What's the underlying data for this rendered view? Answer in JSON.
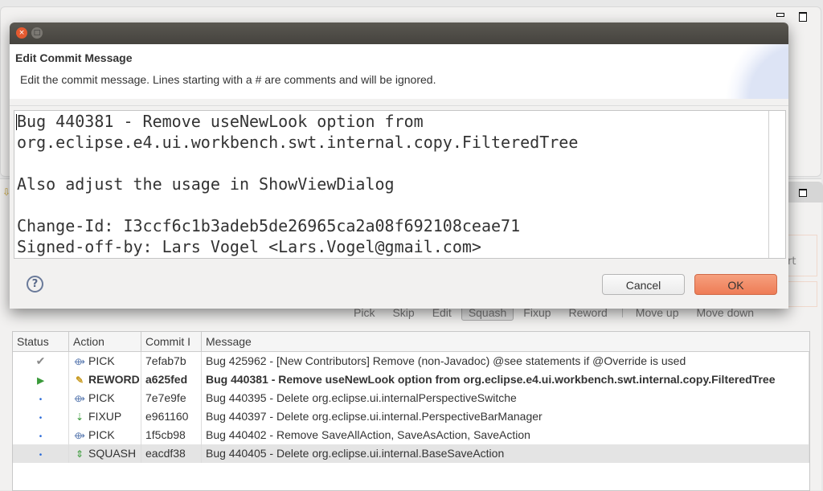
{
  "workbench": {
    "side_icon": "fixup-arrow-icon",
    "partial_text": "rt"
  },
  "toolbar": {
    "buttons": [
      {
        "label": "Pick",
        "pressed": false
      },
      {
        "label": "Skip",
        "pressed": false
      },
      {
        "label": "Edit",
        "pressed": false
      },
      {
        "label": "Squash",
        "pressed": true
      },
      {
        "label": "Fixup",
        "pressed": false
      },
      {
        "label": "Reword",
        "pressed": false
      },
      {
        "label": "Move up",
        "pressed": false
      },
      {
        "label": "Move down",
        "pressed": false
      }
    ]
  },
  "table": {
    "columns": [
      "Status",
      "Action",
      "Commit I",
      "Message"
    ],
    "rows": [
      {
        "status": "done",
        "status_icon": "✔",
        "action_icon": "pick-icon",
        "action": "PICK",
        "commit": "7efab7b",
        "message": "Bug 425962 - [New Contributors] Remove (non-Javadoc) @see statements if @Override is used",
        "bold": false,
        "selected": false
      },
      {
        "status": "current",
        "status_icon": "▶",
        "action_icon": "reword-icon",
        "action": "REWORD",
        "commit": "a625fed",
        "message": "Bug 440381 - Remove useNewLook option from org.eclipse.e4.ui.workbench.swt.internal.copy.FilteredTree",
        "bold": true,
        "selected": false
      },
      {
        "status": "todo",
        "status_icon": "•",
        "action_icon": "pick-icon",
        "action": "PICK",
        "commit": "7e7e9fe",
        "message": "Bug 440395 - Delete org.eclipse.ui.internalPerspectiveSwitche",
        "bold": false,
        "selected": false
      },
      {
        "status": "todo",
        "status_icon": "•",
        "action_icon": "fixup-icon",
        "action": "FIXUP",
        "commit": "e961160",
        "message": "Bug 440397 - Delete org.eclipse.ui.internal.PerspectiveBarManager",
        "bold": false,
        "selected": false
      },
      {
        "status": "todo",
        "status_icon": "•",
        "action_icon": "pick-icon",
        "action": "PICK",
        "commit": "1f5cb98",
        "message": "Bug 440402 - Remove SaveAllAction, SaveAsAction, SaveAction",
        "bold": false,
        "selected": false
      },
      {
        "status": "todo",
        "status_icon": "•",
        "action_icon": "squash-icon",
        "action": "SQUASH",
        "commit": "eacdf38",
        "message": "Bug 440405 - Delete org.eclipse.ui.internal.BaseSaveAction",
        "bold": false,
        "selected": true
      }
    ]
  },
  "dialog": {
    "title": "Edit Commit Message",
    "description": "Edit the commit message. Lines starting with a # are comments and will be ignored.",
    "message_lines": [
      "Bug 440381 - Remove useNewLook option from",
      "org.eclipse.e4.ui.workbench.swt.internal.copy.FilteredTree",
      "",
      "Also adjust the usage in ShowViewDialog",
      "",
      "Change-Id: I3ccf6c1b3adeb5de26965ca2a08f692108ceae71",
      "Signed-off-by: Lars Vogel <Lars.Vogel@gmail.com>"
    ],
    "help_glyph": "?",
    "cancel_label": "Cancel",
    "ok_label": "OK",
    "close_glyph": "×",
    "maximize_glyph": "□"
  }
}
